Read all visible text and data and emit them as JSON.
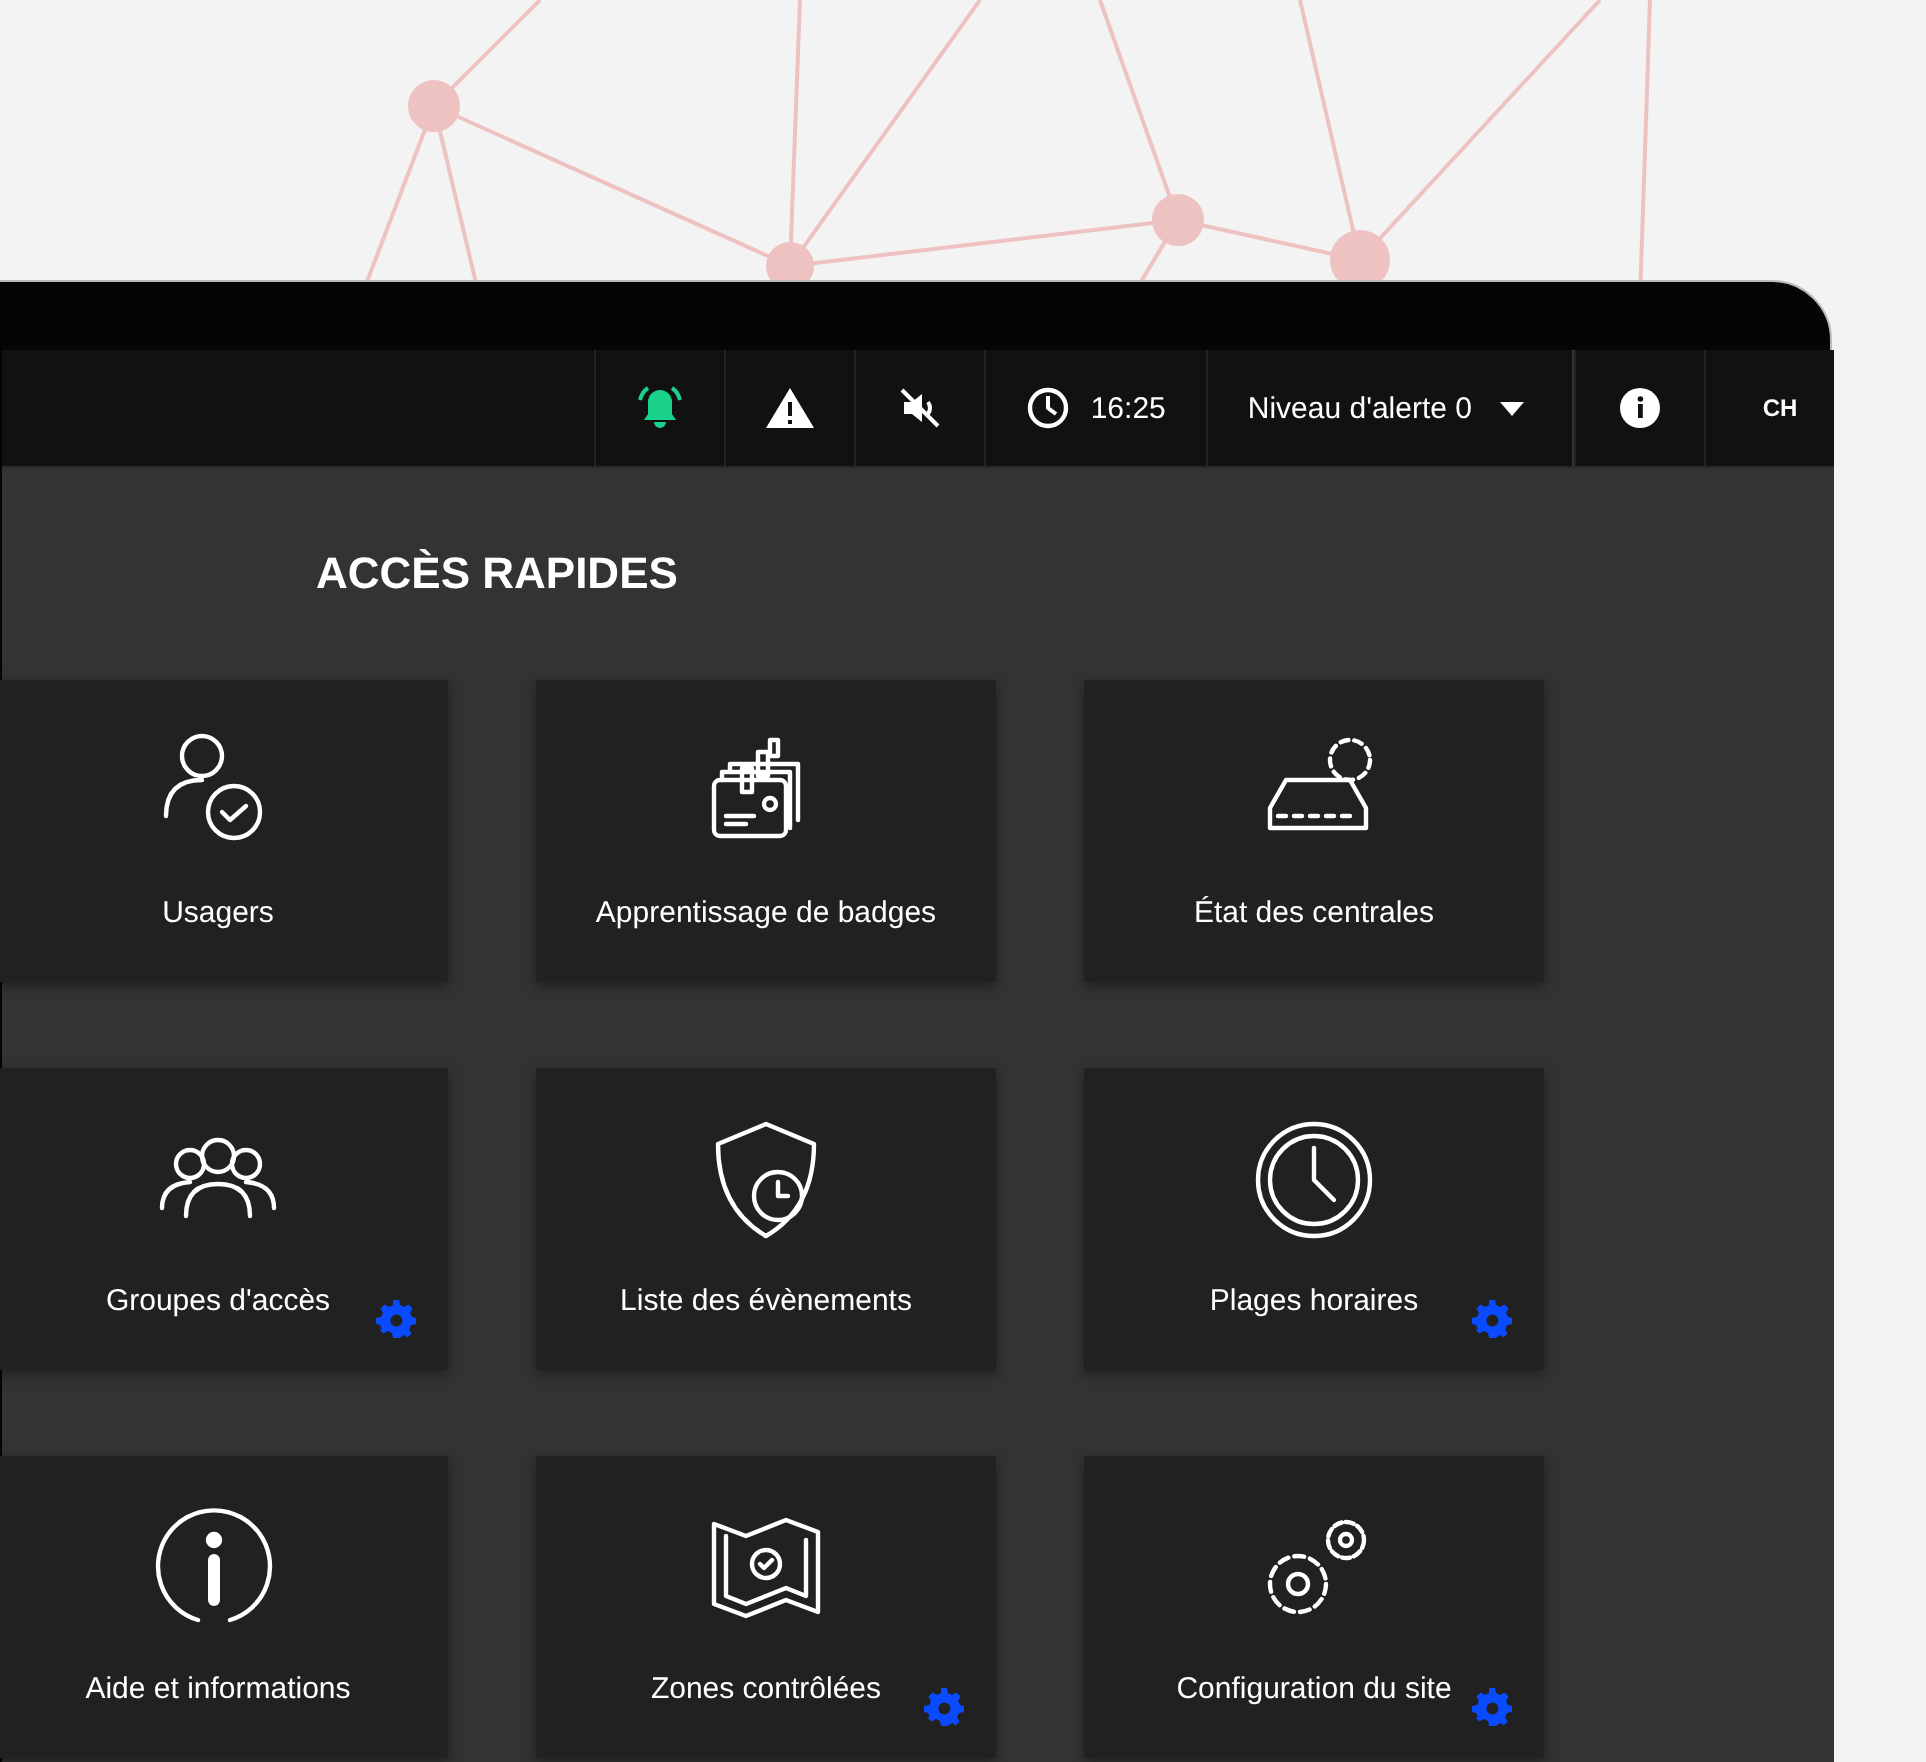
{
  "topbar": {
    "time": "16:25",
    "alert_level": "Niveau d'alerte 0",
    "user_initials": "CH"
  },
  "section_title": "ACCÈS RAPIDES",
  "tiles": [
    {
      "kind": "users",
      "label": "Usagers",
      "settings": false
    },
    {
      "kind": "badges",
      "label": "Apprentissage de badges",
      "settings": false
    },
    {
      "kind": "controller",
      "label": "État des centrales",
      "settings": false
    },
    {
      "kind": "groups",
      "label": "Groupes d'accès",
      "settings": true
    },
    {
      "kind": "events",
      "label": "Liste des évènements",
      "settings": false
    },
    {
      "kind": "schedule",
      "label": "Plages horaires",
      "settings": true
    },
    {
      "kind": "info",
      "label": "Aide et informations",
      "settings": false
    },
    {
      "kind": "zones",
      "label": "Zones contrôlées",
      "settings": true
    },
    {
      "kind": "gears",
      "label": "Configuration du site",
      "settings": true
    }
  ]
}
